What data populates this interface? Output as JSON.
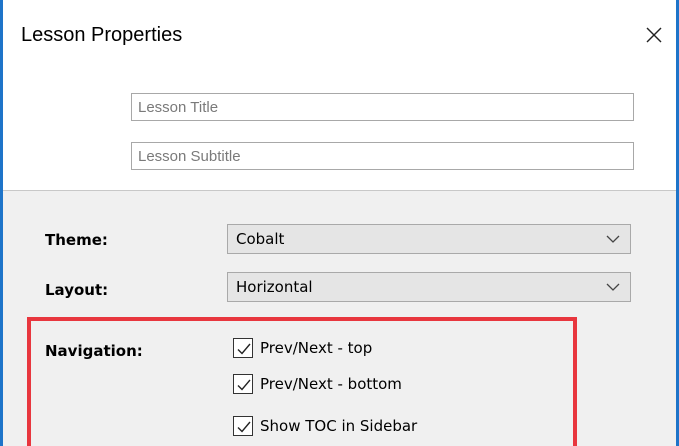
{
  "dialog": {
    "title": "Lesson Properties"
  },
  "fields": {
    "lesson_title": {
      "value": "",
      "placeholder": "Lesson Title"
    },
    "lesson_subtitle": {
      "value": "",
      "placeholder": "Lesson Subtitle"
    }
  },
  "theme": {
    "label": "Theme:",
    "value": "Cobalt"
  },
  "layout": {
    "label": "Layout:",
    "value": "Horizontal"
  },
  "navigation": {
    "label": "Navigation:",
    "options": [
      {
        "label": "Prev/Next - top",
        "checked": true
      },
      {
        "label": "Prev/Next - bottom",
        "checked": true
      },
      {
        "label": "Show TOC in Sidebar",
        "checked": true
      }
    ]
  },
  "colors": {
    "window_border": "#1e74c9",
    "highlight_border": "#e8363e"
  },
  "icons": {
    "close": "close-icon",
    "dropdown": "chevron-down-icon",
    "check": "checkmark-icon"
  }
}
